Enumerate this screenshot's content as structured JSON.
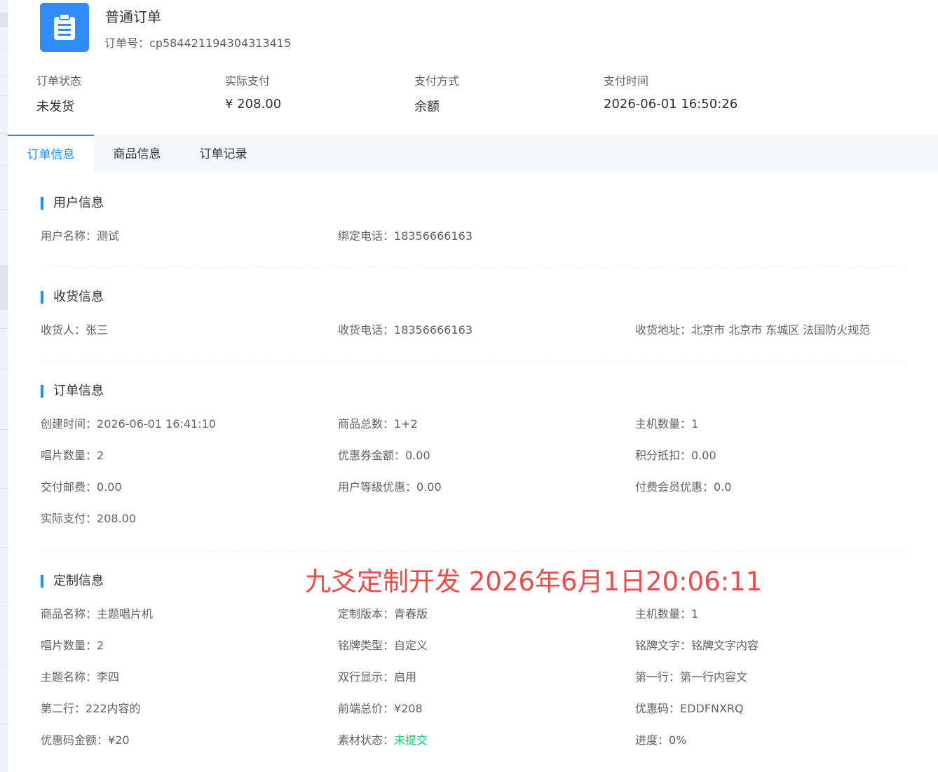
{
  "header": {
    "icon": "clipboard-icon",
    "title": "普通订单",
    "order_no_label": "订单号：",
    "order_no": "cp584421194304313415"
  },
  "summary": [
    {
      "label": "订单状态",
      "value": "未发货"
    },
    {
      "label": "实际支付",
      "value": "¥ 208.00"
    },
    {
      "label": "支付方式",
      "value": "余额"
    },
    {
      "label": "支付时间",
      "value": "2026-06-01 16:50:26"
    }
  ],
  "tabs": [
    "订单信息",
    "商品信息",
    "订单记录"
  ],
  "active_tab": "订单信息",
  "user_section": {
    "title": "用户信息",
    "fields": [
      {
        "label": "用户名称：",
        "value": "测试"
      },
      {
        "label": "绑定电话：",
        "value": "18356666163"
      }
    ]
  },
  "shipping_section": {
    "title": "收货信息",
    "fields": [
      {
        "label": "收货人：",
        "value": "张三"
      },
      {
        "label": "收货电话：",
        "value": "18356666163"
      },
      {
        "label": "收货地址：",
        "value": "北京市 北京市 东城区 法国防火规范"
      }
    ]
  },
  "order_section": {
    "title": "订单信息",
    "fields": [
      {
        "label": "创建时间：",
        "value": "2026-06-01 16:41:10"
      },
      {
        "label": "商品总数：",
        "value": "1+2"
      },
      {
        "label": "主机数量：",
        "value": "1"
      },
      {
        "label": "唱片数量：",
        "value": "2"
      },
      {
        "label": "优惠券金额：",
        "value": "0.00"
      },
      {
        "label": "积分抵扣：",
        "value": "0.00"
      },
      {
        "label": "交付邮费：",
        "value": "0.00"
      },
      {
        "label": "用户等级优惠：",
        "value": "0.00"
      },
      {
        "label": "付费会员优惠：",
        "value": "0.0"
      },
      {
        "label": "实际支付：",
        "value": "208.00"
      }
    ]
  },
  "custom_section": {
    "title": "定制信息",
    "fields": [
      {
        "label": "商品名称：",
        "value": "主题唱片机"
      },
      {
        "label": "定制版本：",
        "value": "青春版"
      },
      {
        "label": "主机数量：",
        "value": "1"
      },
      {
        "label": "唱片数量：",
        "value": "2"
      },
      {
        "label": "铭牌类型：",
        "value": "自定义"
      },
      {
        "label": "铭牌文字：",
        "value": "铭牌文字内容"
      },
      {
        "label": "主题名称：",
        "value": "李四"
      },
      {
        "label": "双行显示：",
        "value": "启用"
      },
      {
        "label": "第一行：",
        "value": "第一行内容文"
      },
      {
        "label": "第二行：",
        "value": "222内容的"
      },
      {
        "label": "前端总价：",
        "value": "¥208"
      },
      {
        "label": "优惠码：",
        "value": "EDDFNXRQ"
      },
      {
        "label": "优惠码金额：",
        "value": "¥20"
      },
      {
        "label": "素材状态：",
        "value": "未提交"
      },
      {
        "label": "进度：",
        "value": "0%"
      }
    ]
  },
  "watermark": "九爻定制开发  2026年6月1日20:06:11",
  "colors": {
    "accent": "#1890ff",
    "icon_bg": "#2f8cf8",
    "success": "#13ce66",
    "watermark": "#f04a4a"
  }
}
